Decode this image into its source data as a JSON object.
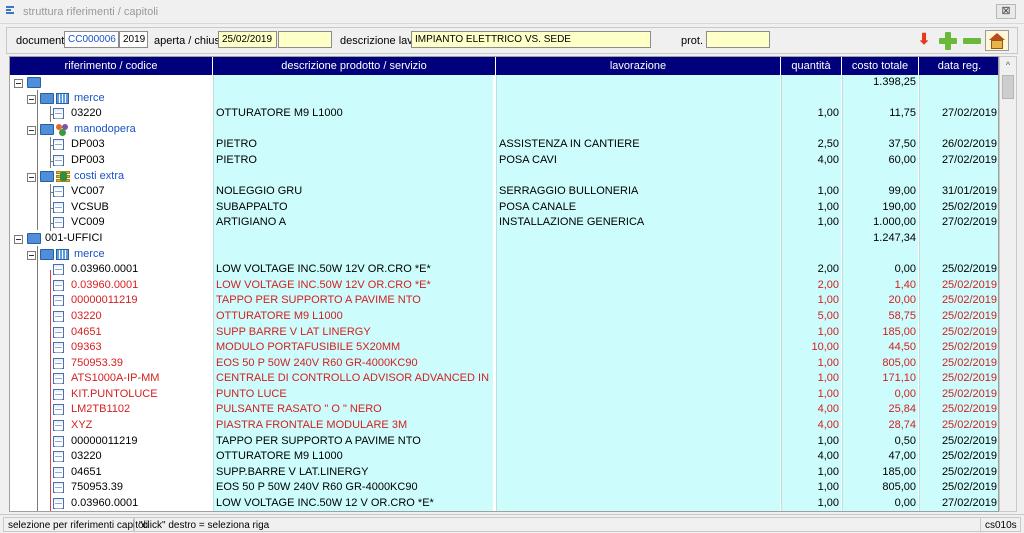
{
  "window": {
    "title": "struttura riferimenti / capitoli",
    "close_glyph": "⊠"
  },
  "toolbar": {
    "documento_label": "documento",
    "documento_value": "CC000006",
    "anno_value": "2019",
    "aperta_label": "aperta / chiusa",
    "aperta_value": "25/02/2019",
    "chiusa_value": "",
    "descrizione_label": "descrizione lavori",
    "descrizione_value": "IMPIANTO ELETTRICO VS. SEDE",
    "prot_label": "prot.",
    "prot_value": "",
    "icons": [
      "red-down-arrow-icon",
      "green-plus-icon",
      "green-minus-icon",
      "home-icon"
    ],
    "arrow_glyph": "⬇"
  },
  "columns": {
    "ref": "riferimento / codice",
    "desc": "descrizione prodotto / servizio",
    "work": "lavorazione",
    "qty": "quantità",
    "cost": "costo totale",
    "date": "data reg."
  },
  "rows": [
    {
      "ref": "",
      "desc": "",
      "work": "",
      "qty": "",
      "cost": "1.398,25",
      "date": ""
    },
    {
      "ref": "merce",
      "desc": "",
      "work": "",
      "qty": "",
      "cost": "",
      "date": ""
    },
    {
      "ref": "03220",
      "desc": "OTTURATORE M9 L1000",
      "work": "",
      "qty": "1,00",
      "cost": "11,75",
      "date": "27/02/2019"
    },
    {
      "ref": "manodopera",
      "desc": "",
      "work": "",
      "qty": "",
      "cost": "",
      "date": ""
    },
    {
      "ref": "DP003",
      "desc": "PIETRO",
      "work": "ASSISTENZA IN CANTIERE",
      "qty": "2,50",
      "cost": "37,50",
      "date": "26/02/2019"
    },
    {
      "ref": "DP003",
      "desc": "PIETRO",
      "work": "POSA CAVI",
      "qty": "4,00",
      "cost": "60,00",
      "date": "27/02/2019"
    },
    {
      "ref": "costi extra",
      "desc": "",
      "work": "",
      "qty": "",
      "cost": "",
      "date": ""
    },
    {
      "ref": "VC007",
      "desc": "NOLEGGIO GRU",
      "work": "SERRAGGIO BULLONERIA",
      "qty": "1,00",
      "cost": "99,00",
      "date": "31/01/2019"
    },
    {
      "ref": "VCSUB",
      "desc": "SUBAPPALTO",
      "work": "POSA CANALE",
      "qty": "1,00",
      "cost": "190,00",
      "date": "25/02/2019"
    },
    {
      "ref": "VC009",
      "desc": "ARTIGIANO A",
      "work": "INSTALLAZIONE GENERICA",
      "qty": "1,00",
      "cost": "1.000,00",
      "date": "27/02/2019"
    },
    {
      "ref": "001-UFFICI",
      "desc": "",
      "work": "",
      "qty": "",
      "cost": "1.247,34",
      "date": ""
    },
    {
      "ref": "merce",
      "desc": "",
      "work": "",
      "qty": "",
      "cost": "",
      "date": ""
    },
    {
      "ref": "0.03960.0001",
      "desc": "LOW VOLTAGE INC.50W 12V OR.CRO *E*",
      "work": "",
      "qty": "2,00",
      "cost": "0,00",
      "date": "25/02/2019"
    },
    {
      "ref": "0.03960.0001",
      "desc": "LOW VOLTAGE INC.50W 12V OR.CRO *E*",
      "work": "",
      "qty": "2,00",
      "cost": "1,40",
      "date": "25/02/2019"
    },
    {
      "ref": "00000011219",
      "desc": "TAPPO PER SUPPORTO A PAVIME   NTO",
      "work": "",
      "qty": "1,00",
      "cost": "20,00",
      "date": "25/02/2019"
    },
    {
      "ref": "03220",
      "desc": "OTTURATORE M9 L1000",
      "work": "",
      "qty": "5,00",
      "cost": "58,75",
      "date": "25/02/2019"
    },
    {
      "ref": "04651",
      "desc": "SUPP BARRE V LAT LINERGY",
      "work": "",
      "qty": "1,00",
      "cost": "185,00",
      "date": "25/02/2019"
    },
    {
      "ref": "09363",
      "desc": "MODULO PORTAFUSIBILE 5X20MM",
      "work": "",
      "qty": "10,00",
      "cost": "44,50",
      "date": "25/02/2019"
    },
    {
      "ref": "750953.39",
      "desc": "EOS 50 P 50W 240V R60  GR-4000KC90",
      "work": "",
      "qty": "1,00",
      "cost": "805,00",
      "date": "25/02/2019"
    },
    {
      "ref": "ATS1000A-IP-MM",
      "desc": "CENTRALE  DI CONTROLLO ADVISOR ADVANCED IN",
      "work": "",
      "qty": "1,00",
      "cost": "171,10",
      "date": "25/02/2019"
    },
    {
      "ref": "KIT.PUNTOLUCE",
      "desc": "PUNTO LUCE",
      "work": "",
      "qty": "1,00",
      "cost": "0,00",
      "date": "25/02/2019"
    },
    {
      "ref": "LM2TB1102",
      "desc": "PULSANTE  RASATO \" O \" NERO",
      "work": "",
      "qty": "4,00",
      "cost": "25,84",
      "date": "25/02/2019"
    },
    {
      "ref": "XYZ",
      "desc": "PIASTRA FRONTALE MODULARE 3M",
      "work": "",
      "qty": "4,00",
      "cost": "28,74",
      "date": "25/02/2019"
    },
    {
      "ref": "00000011219",
      "desc": "TAPPO PER SUPPORTO A PAVIME   NTO",
      "work": "",
      "qty": "1,00",
      "cost": "0,50",
      "date": "25/02/2019"
    },
    {
      "ref": "03220",
      "desc": "OTTURATORE M9 L1000",
      "work": "",
      "qty": "4,00",
      "cost": "47,00",
      "date": "25/02/2019"
    },
    {
      "ref": "04651",
      "desc": "SUPP.BARRE V LAT.LINERGY",
      "work": "",
      "qty": "1,00",
      "cost": "185,00",
      "date": "25/02/2019"
    },
    {
      "ref": "750953.39",
      "desc": "EOS 50 P 50W 240V R60  GR-4000KC90",
      "work": "",
      "qty": "1,00",
      "cost": "805,00",
      "date": "25/02/2019"
    },
    {
      "ref": "0.03960.0001",
      "desc": "LOW VOLTAGE INC.50W 12 V OR.CRO *E*",
      "work": "",
      "qty": "1,00",
      "cost": "0,00",
      "date": "27/02/2019"
    }
  ],
  "colors": {
    "header_bg": "#00007c",
    "cell_bg": "#ccfcfc",
    "highlight_text": "#d41f1f",
    "group_text": "#1b52c6",
    "field_yellow": "#ffffc8"
  },
  "status": {
    "left": "selezione per riferimenti capitoli",
    "hint": "\"click\" destro = seleziona riga",
    "code": "cs010s"
  },
  "scrollbar": {
    "up_glyph": "^"
  }
}
